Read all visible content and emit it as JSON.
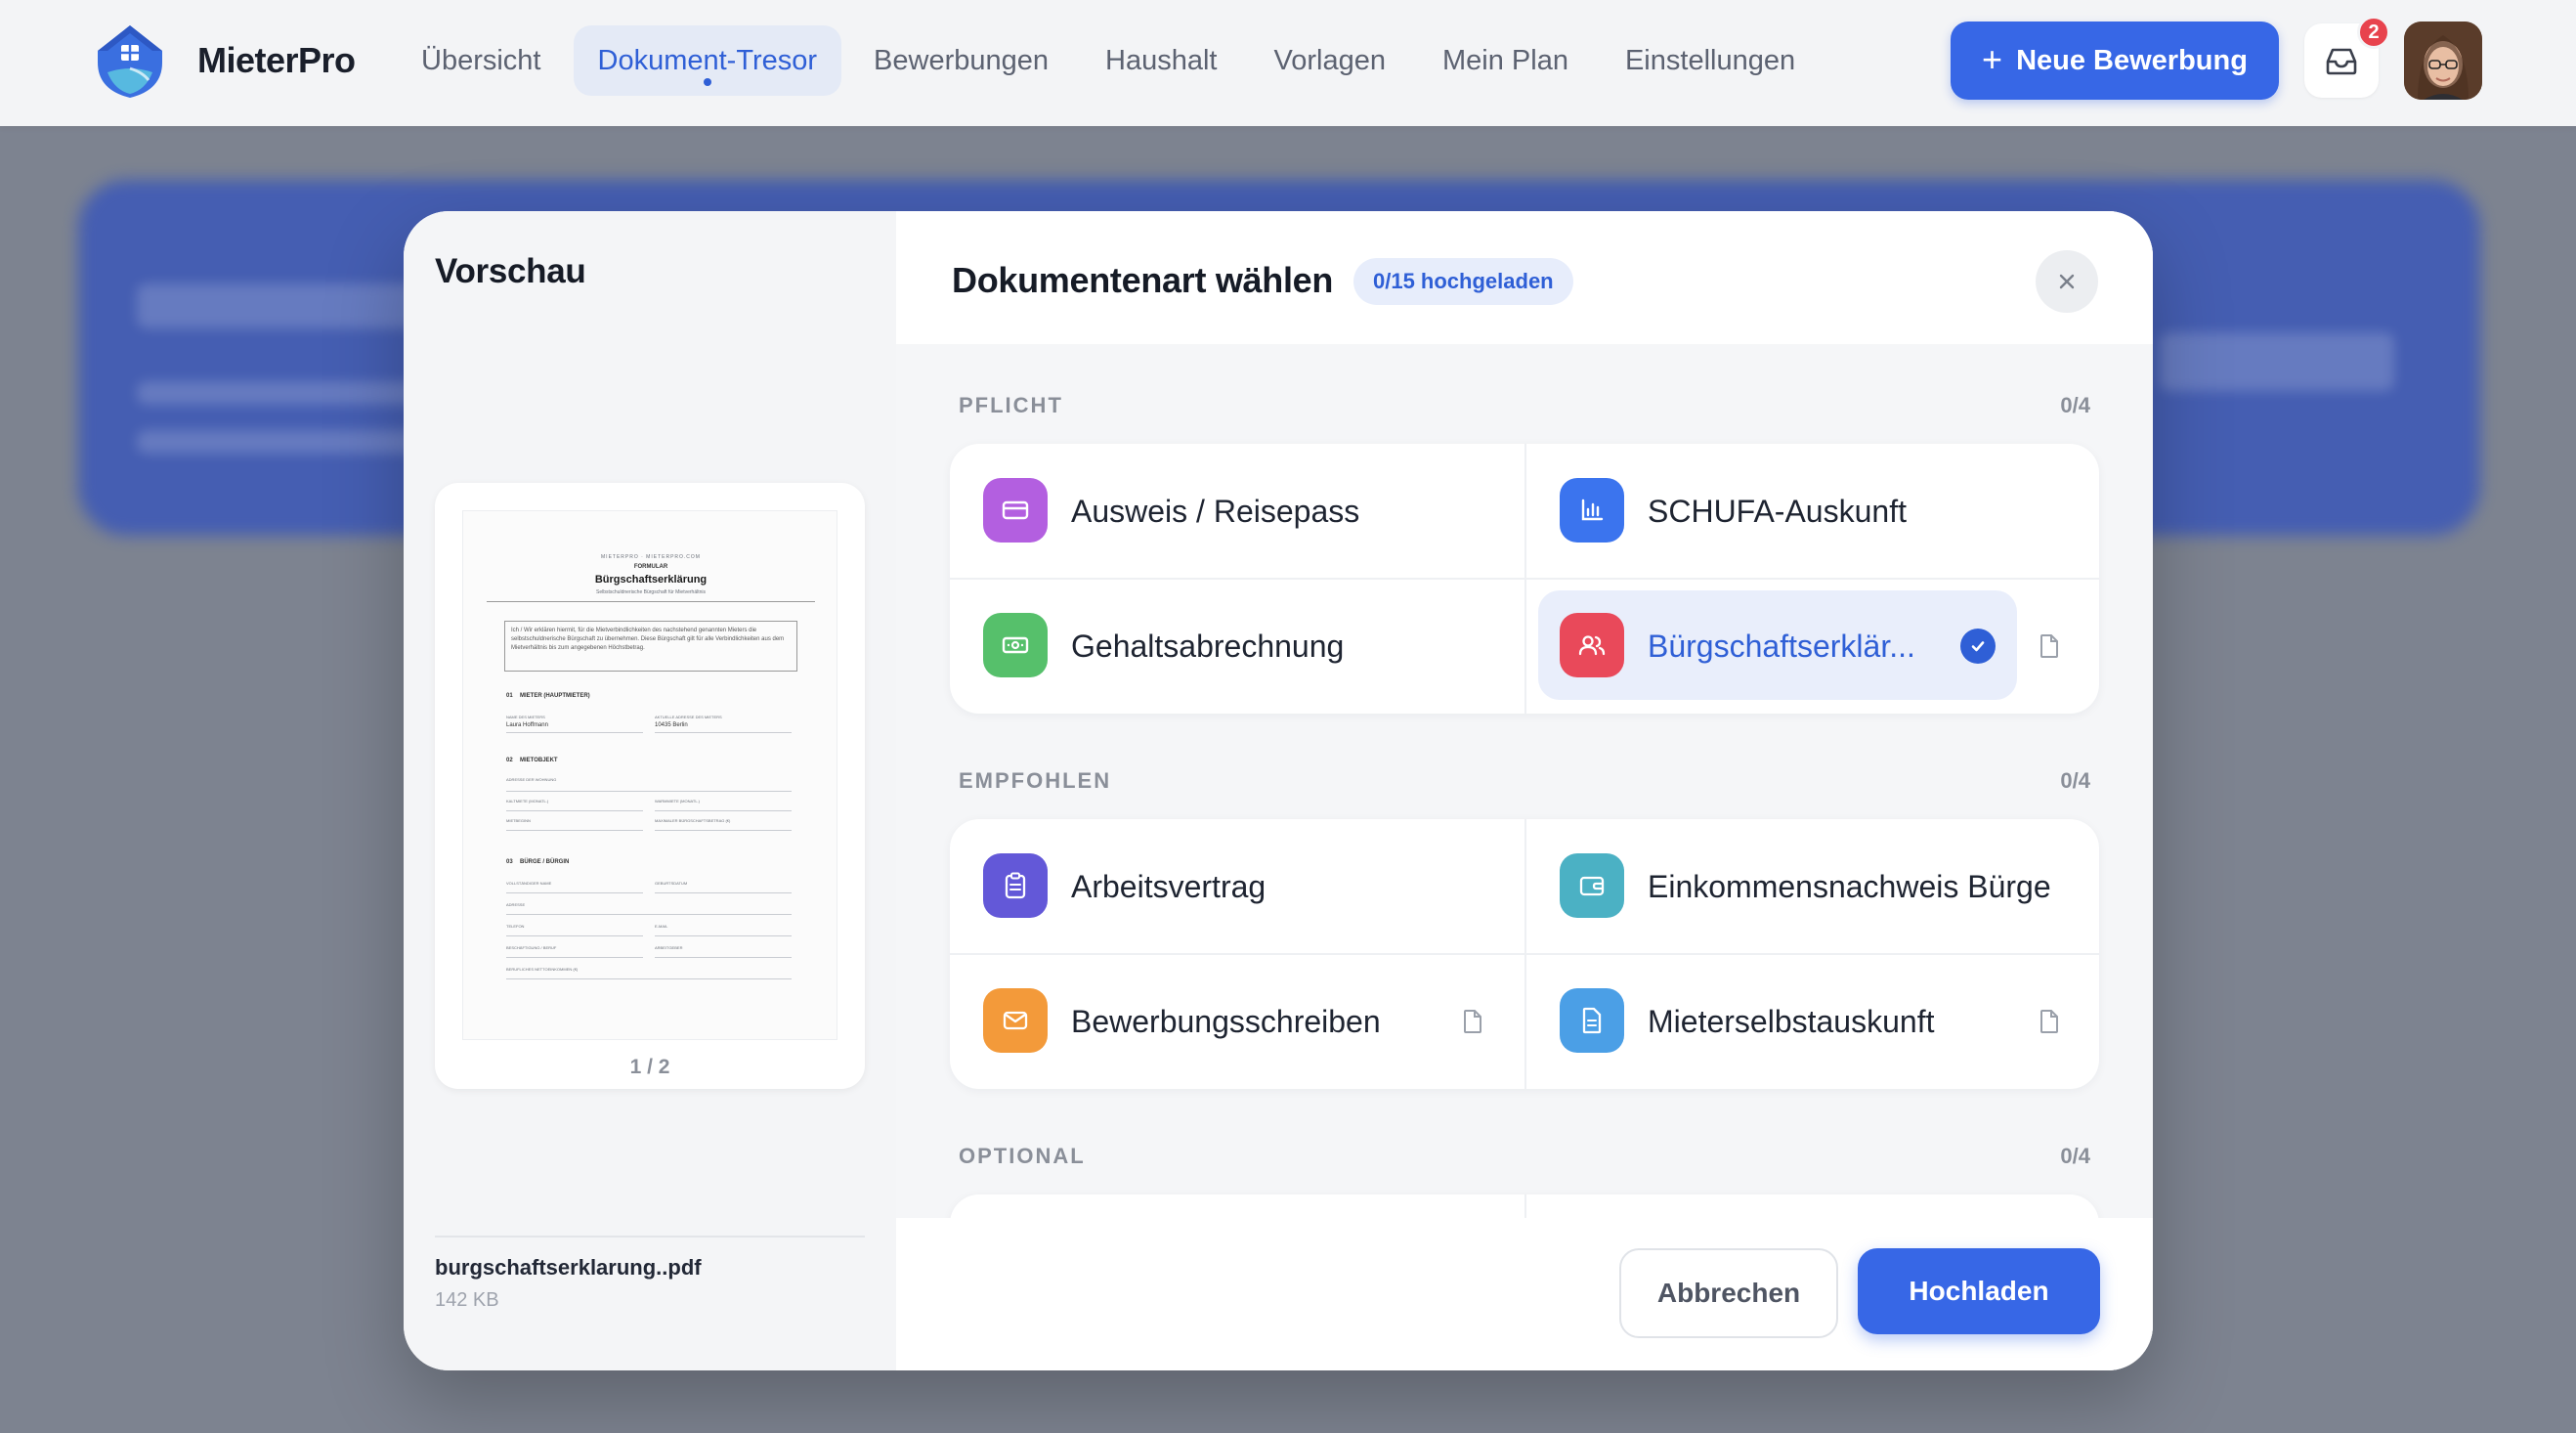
{
  "app": {
    "brand_name": "MieterPro",
    "accent_color": "#3767e6"
  },
  "nav": {
    "items": [
      {
        "label": "Übersicht"
      },
      {
        "label": "Dokument-Tresor",
        "active": true
      },
      {
        "label": "Bewerbungen"
      },
      {
        "label": "Haushalt"
      },
      {
        "label": "Vorlagen"
      },
      {
        "label": "Mein Plan"
      },
      {
        "label": "Einstellungen"
      }
    ],
    "cta_icon": "+",
    "cta_label": "Neue Bewerbung",
    "inbox_badge": "2"
  },
  "preview": {
    "title": "Vorschau",
    "page_indicator": "1 / 2",
    "file_name": "burgschaftserklarung..pdf",
    "file_size": "142 KB",
    "document": {
      "header_small": "MIETERPRO · MIETERPRO.COM",
      "kind": "FORMULAR",
      "title": "Bürgschaftserklärung",
      "subtitle": "Selbstschuldnerische Bürgschaft für Mietverhältnis",
      "intro": "Ich / Wir erklären hiermit, für die Mietverbindlichkeiten des nachstehend genannten Mieters die selbstschuldnerische Bürgschaft zu übernehmen. Diese Bürgschaft gilt für alle Verbindlichkeiten aus dem Mietverhältnis bis zum angegebenen Höchstbetrag.",
      "sections": [
        {
          "num": "01",
          "title": "MIETER (HAUPTMIETER)",
          "fields": [
            "NAME DES MIETERS",
            "AKTUELLE ADRESSE DES MIETERS"
          ],
          "values": [
            "Laura Hoffmann",
            "10435 Berlin"
          ]
        },
        {
          "num": "02",
          "title": "MIETOBJEKT",
          "fields": [
            "ADRESSE DER WOHNUNG",
            "KALTMIETE (MONATL.)",
            "WARMMIETE (MONATL.)",
            "MIETBEGINN",
            "MAXIMALER BÜRGSCHAFTSBETRAG (€)"
          ]
        },
        {
          "num": "03",
          "title": "BÜRGE / BÜRGIN",
          "fields": [
            "VOLLSTÄNDIGER NAME",
            "GEBURTSDATUM",
            "ADRESSE",
            "TELEFON",
            "E-MAIL",
            "BESCHÄFTIGUNG / BERUF",
            "ARBEITGEBER",
            "BERUFLICHES NETTOEINKOMMEN (€)"
          ]
        }
      ]
    }
  },
  "panel": {
    "title": "Dokumentenart wählen",
    "progress": "0/15 hochgeladen",
    "groups": [
      {
        "label": "PFLICHT",
        "count": "0/4",
        "items": [
          {
            "label": "Ausweis / Reisepass",
            "icon": "id-card-icon",
            "color": "#b35fe0"
          },
          {
            "label": "SCHUFA-Auskunft",
            "icon": "bar-chart-icon",
            "color": "#3b74ee"
          },
          {
            "label": "Gehaltsabrechnung",
            "icon": "banknote-icon",
            "color": "#56c06b"
          },
          {
            "label": "Bürgschaftserklär...",
            "icon": "users-icon",
            "color": "#e9495a",
            "selected": true
          }
        ]
      },
      {
        "label": "EMPFOHLEN",
        "count": "0/4",
        "items": [
          {
            "label": "Arbeitsvertrag",
            "icon": "clipboard-icon",
            "color": "#6358d8"
          },
          {
            "label": "Einkommensnachweis Bürge",
            "icon": "wallet-icon",
            "color": "#4bb1c4"
          },
          {
            "label": "Bewerbungsschreiben",
            "icon": "mail-icon",
            "color": "#f39a3a"
          },
          {
            "label": "Mieterselbstauskunft",
            "icon": "document-icon",
            "color": "#4b9fe6"
          }
        ]
      },
      {
        "label": "OPTIONAL",
        "count": "0/4"
      }
    ],
    "cancel_label": "Abbrechen",
    "upload_label": "Hochladen"
  }
}
